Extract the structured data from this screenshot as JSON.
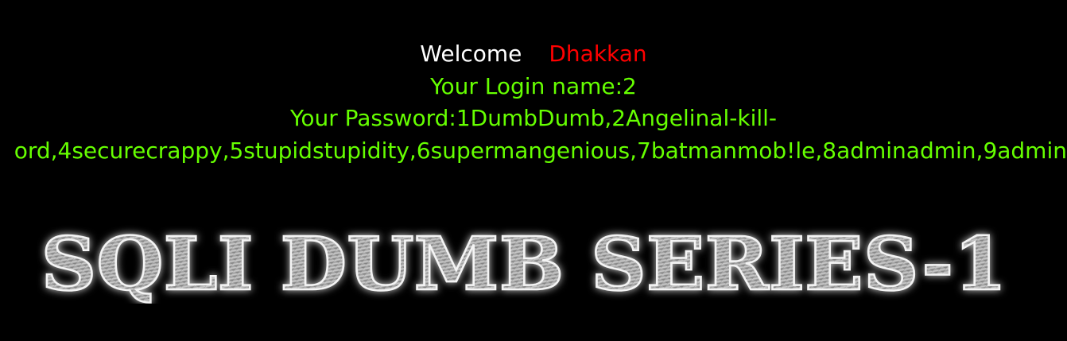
{
  "welcome": {
    "label": "Welcome",
    "username": "Dhakkan"
  },
  "login": {
    "label_text": "Your Login name:2"
  },
  "password": {
    "label_text": "Your Password:1DumbDumb,2Angelinal-kill-",
    "wrap_line": "ord,4securecrappy,5stupidstupidity,6supermangenious,7batmanmob!le,8adminadmin,9admin"
  },
  "banner": {
    "title": "SQLI DUMB SERIES-1"
  },
  "colors": {
    "background": "#000000",
    "welcome": "#ffffff",
    "username": "#ff0000",
    "info": "#66ff00"
  }
}
